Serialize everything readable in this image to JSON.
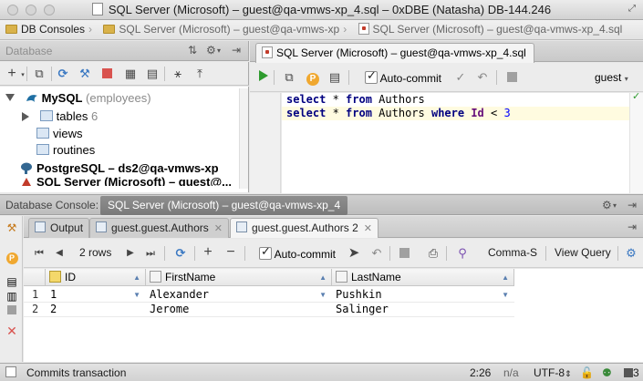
{
  "window": {
    "title": "SQL Server (Microsoft) – guest@qa-vmws-xp_4.sql – 0xDBE (Natasha) DB-144.246"
  },
  "breadcrumb": {
    "items": [
      "DB Consoles",
      "SQL Server (Microsoft) – guest@qa-vmws-xp",
      "SQL Server (Microsoft) – guest@qa-vmws-xp_4.sql"
    ]
  },
  "db_panel": {
    "header_label": "Database",
    "tree": [
      {
        "label": "MySQL",
        "suffix": "(employees)",
        "color": "#1f6fa3"
      },
      {
        "label": "tables",
        "suffix": "6"
      },
      {
        "label": "views"
      },
      {
        "label": "routines"
      },
      {
        "label": "PostgreSQL – ds2@qa-vmws-xp"
      },
      {
        "label": "SQL Server (Microsoft) – guest@..."
      }
    ]
  },
  "editor": {
    "tab_label": "SQL Server (Microsoft) – guest@qa-vmws-xp_4.sql",
    "autocommit_label": "Auto-commit",
    "schema_label": "guest",
    "code": {
      "line1": {
        "kw1": "select",
        "star": " * ",
        "kw2": "from",
        "table": " Authors"
      },
      "line2": {
        "kw1": "select",
        "star": " * ",
        "kw2": "from",
        "table": " Authors ",
        "kw3": "where",
        "column": " Id",
        "op": " < ",
        "value": "3"
      }
    }
  },
  "console": {
    "label": "Database Console:",
    "active_tab": "SQL Server (Microsoft) – guest@qa-vmws-xp_4",
    "tabs": [
      {
        "label": "Output"
      },
      {
        "label": "guest.guest.Authors"
      },
      {
        "label": "guest.guest.Authors 2"
      }
    ],
    "toolbar": {
      "rows_label": "2 rows",
      "autocommit_label": "Auto-commit",
      "csv_label": "Comma-S",
      "view_query_label": "View Query"
    },
    "grid": {
      "columns": [
        "ID",
        "FirstName",
        "LastName"
      ],
      "rows": [
        {
          "num": "1",
          "id": "1",
          "first": "Alexander",
          "last": "Pushkin"
        },
        {
          "num": "2",
          "id": "2",
          "first": "Jerome",
          "last": "Salinger"
        }
      ]
    }
  },
  "statusbar": {
    "message": "Commits transaction",
    "position": "2:26",
    "na": "n/a",
    "encoding": "UTF-8",
    "count": "3"
  },
  "colors": {
    "run": "#2e9b2e",
    "stop": "#d9534f",
    "keyword": "#000080",
    "number": "#0000ff"
  }
}
